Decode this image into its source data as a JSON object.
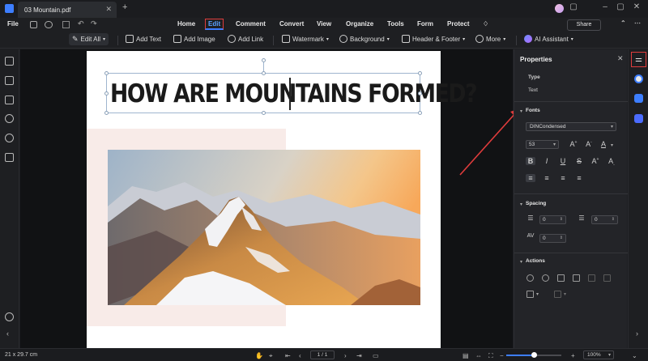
{
  "tab": {
    "title": "03 Mountain.pdf"
  },
  "menu": {
    "file": "File",
    "items": [
      "Home",
      "Edit",
      "Comment",
      "Convert",
      "View",
      "Organize",
      "Tools",
      "Form",
      "Protect"
    ],
    "share": "Share"
  },
  "toolbar": {
    "edit_all": "Edit All",
    "add_text": "Add Text",
    "add_image": "Add Image",
    "add_link": "Add Link",
    "watermark": "Watermark",
    "background": "Background",
    "header_footer": "Header & Footer",
    "more": "More",
    "ai_assistant": "AI Assistant"
  },
  "document": {
    "title_text": "HOW ARE MOUNTAINS FORMED?"
  },
  "properties": {
    "title": "Properties",
    "type_label": "Type",
    "type_value": "Text",
    "fonts_label": "Fonts",
    "font_name": "DINCondensed",
    "font_size": "53",
    "spacing_label": "Spacing",
    "line_spacing": "0",
    "char_spacing": "0",
    "para_spacing": "0",
    "actions_label": "Actions"
  },
  "status": {
    "page_size": "21 x 29.7 cm",
    "page_indicator": "1 / 1",
    "zoom": "100%"
  },
  "colors": {
    "accent": "#3d7eff",
    "highlight_red": "#e03c3c",
    "panel_bg": "#232428",
    "app_bg": "#1e1f22"
  }
}
